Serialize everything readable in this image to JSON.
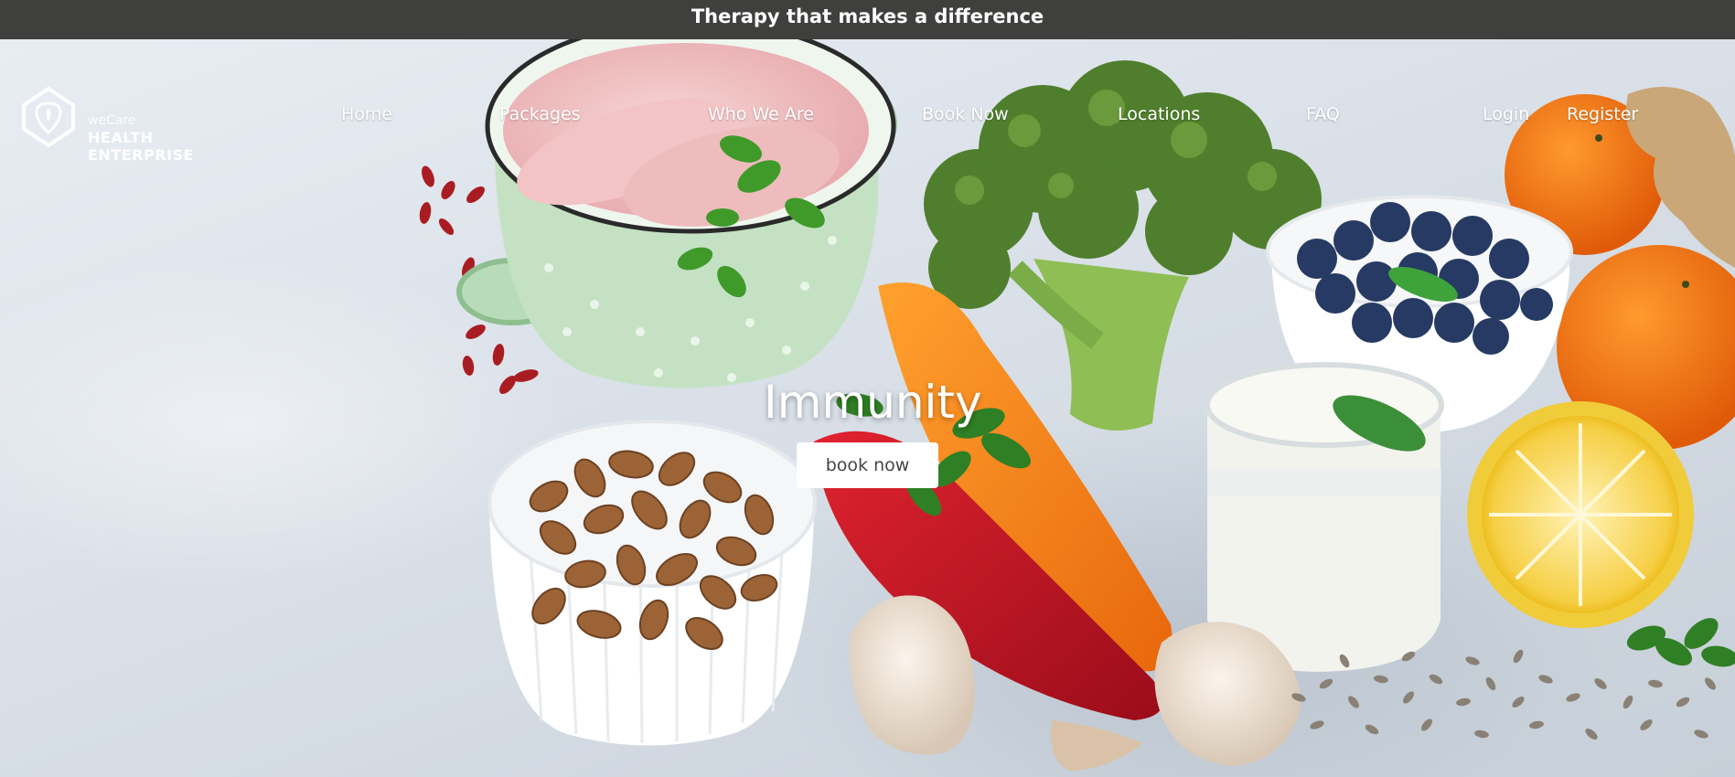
{
  "topbar": {
    "text": "Therapy that makes a difference"
  },
  "logo": {
    "small": "weCare",
    "big": "HEALTH ENTERPRISE"
  },
  "nav": {
    "items": [
      {
        "label": "Home"
      },
      {
        "label": "Packages"
      },
      {
        "label": "Who We Are"
      },
      {
        "label": "Book Now"
      },
      {
        "label": "Locations"
      },
      {
        "label": "FAQ"
      }
    ]
  },
  "account": {
    "login": "Login",
    "register": "Register"
  },
  "hero": {
    "caption": "Immunity",
    "button": "book now"
  },
  "carousel": {
    "slides": 4,
    "active_slide": 4
  },
  "colors": {
    "topbar": "#3f3f3d",
    "background": "#dde3ea",
    "text": "#ffffff",
    "button_text": "#444444"
  }
}
